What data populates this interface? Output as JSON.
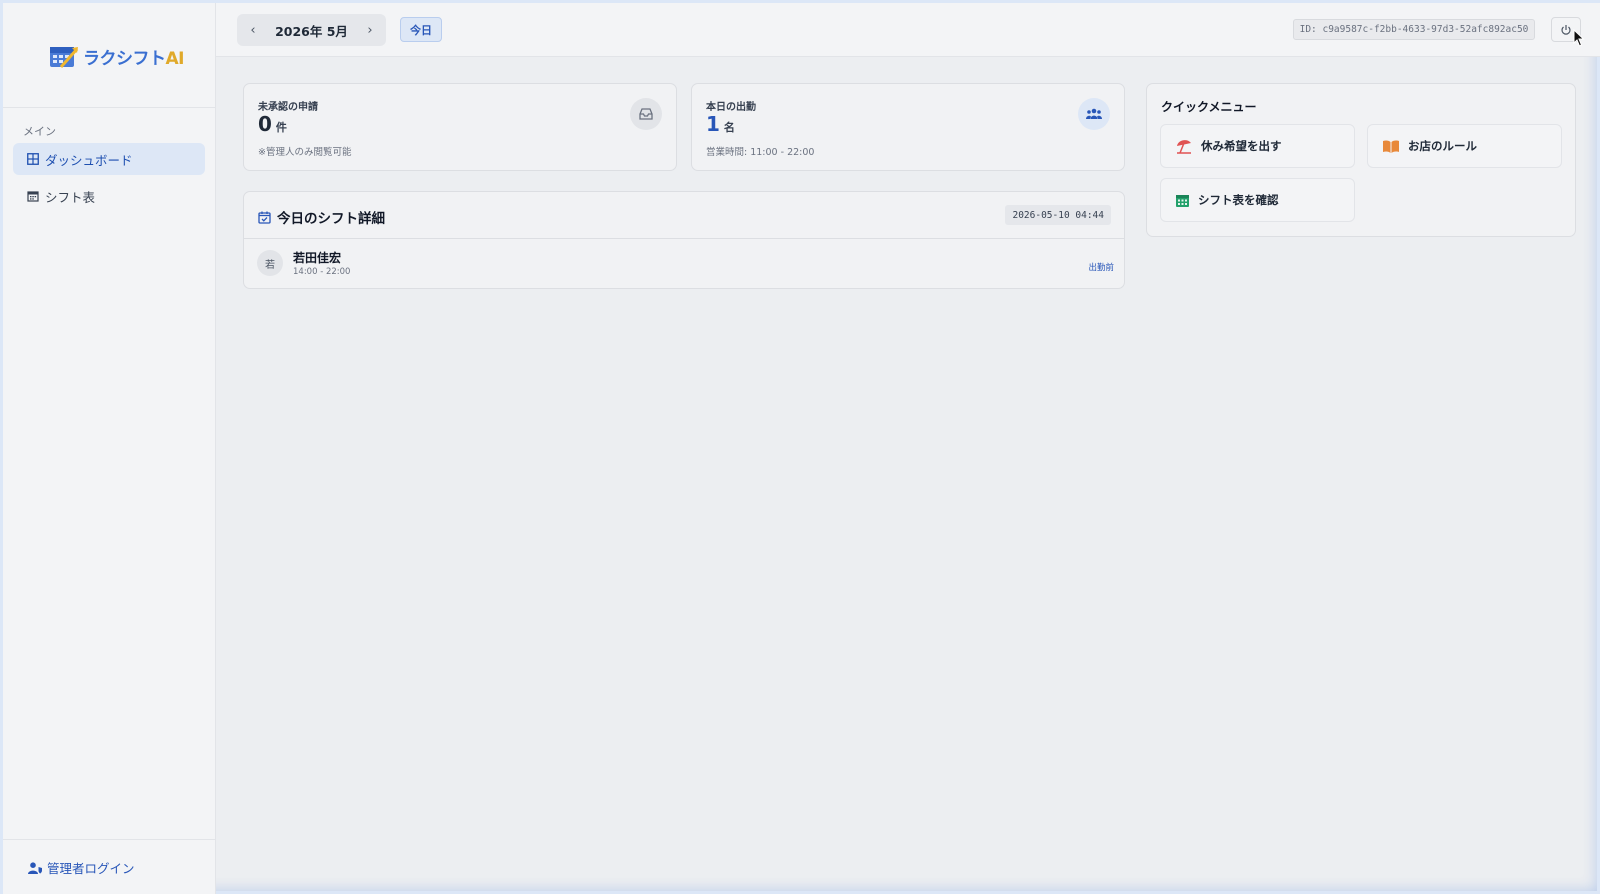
{
  "app": {
    "logo_text": "ラクシフト",
    "logo_ai": "AI"
  },
  "sidebar": {
    "section_label": "メイン",
    "items": [
      {
        "label": "ダッシュボード",
        "icon": "grid-icon",
        "active": true
      },
      {
        "label": "シフト表",
        "icon": "calendar-icon",
        "active": false
      }
    ],
    "admin_login_label": "管理者ログイン"
  },
  "header": {
    "month_label": "2026年 5月",
    "prev_arrow": "‹",
    "next_arrow": "›",
    "today_label": "今日",
    "session_id": "ID: c9a9587c-f2bb-4633-97d3-52afc892ac50"
  },
  "stats": {
    "pending": {
      "title": "未承認の申請",
      "value": "0",
      "unit": "件",
      "note": "※管理人のみ閲覧可能",
      "icon": "inbox-icon"
    },
    "attendance": {
      "title": "本日の出勤",
      "value": "1",
      "unit": "名",
      "note": "営業時間: 11:00 - 22:00",
      "icon": "users-icon"
    }
  },
  "today_shift": {
    "title": "今日のシフト詳細",
    "timestamp": "2026-05-10 04:44",
    "entries": [
      {
        "avatar": "若",
        "name": "若田佳宏",
        "time": "14:00 - 22:00",
        "status": "出勤前"
      }
    ]
  },
  "quick_menu": {
    "title": "クイックメニュー",
    "items": [
      {
        "label": "休み希望を出す",
        "icon": "umbrella-beach-icon",
        "color": "#e05252"
      },
      {
        "label": "お店のルール",
        "icon": "book-icon",
        "color": "#e8893a"
      },
      {
        "label": "シフト表を確認",
        "icon": "calendar-icon",
        "color": "#22a06b"
      }
    ]
  },
  "colors": {
    "accent": "#2856b8",
    "active_bg": "#dde7f6"
  }
}
